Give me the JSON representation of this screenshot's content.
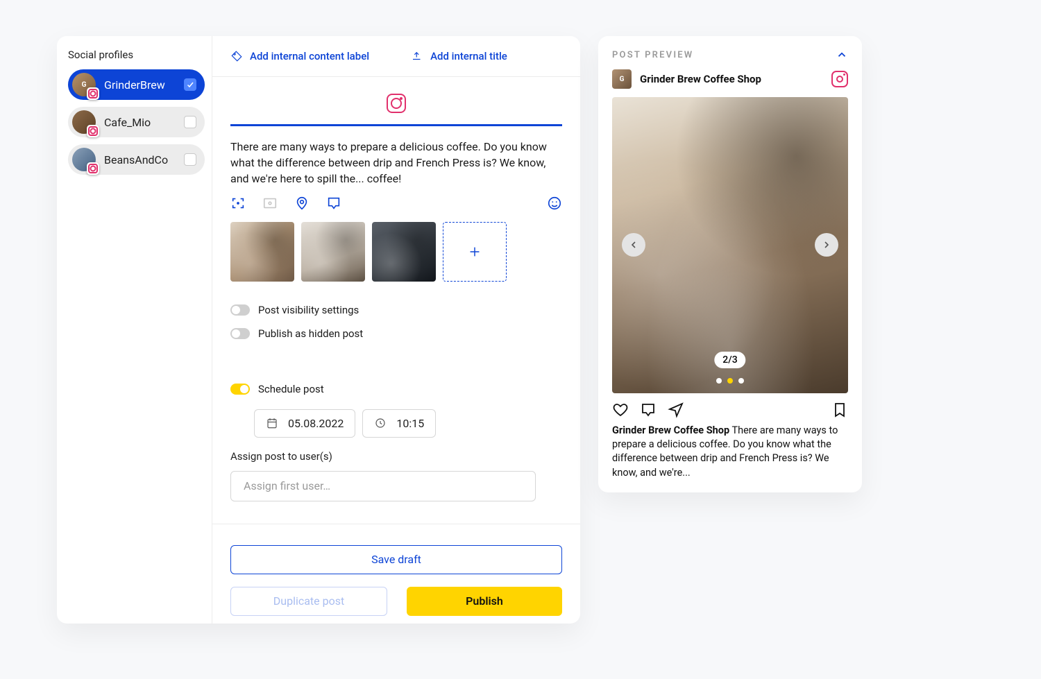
{
  "sidebar": {
    "title": "Social profiles",
    "profiles": [
      {
        "name": "GrinderBrew",
        "selected": true
      },
      {
        "name": "Cafe_Mio",
        "selected": false
      },
      {
        "name": "BeansAndCo",
        "selected": false
      }
    ]
  },
  "editor": {
    "add_label_link": "Add internal content label",
    "add_title_link": "Add internal title",
    "caption": "There are many ways to prepare a delicious coffee. Do you know what the difference between drip and French Press is? We know, and we're here to spill the... coffee!",
    "toggles": {
      "visibility": {
        "label": "Post visibility settings",
        "on": false
      },
      "hidden_post": {
        "label": "Publish as hidden post",
        "on": false
      },
      "schedule": {
        "label": "Schedule post",
        "on": true
      }
    },
    "schedule": {
      "date": "05.08.2022",
      "time": "10:15"
    },
    "assign_label": "Assign post to user(s)",
    "assign_placeholder": "Assign first user…",
    "buttons": {
      "save_draft": "Save draft",
      "duplicate": "Duplicate post",
      "publish": "Publish"
    }
  },
  "preview": {
    "heading": "POST PREVIEW",
    "account_name": "Grinder Brew Coffee Shop",
    "counter": "2/3",
    "caption_name": "Grinder Brew Coffee Shop",
    "caption_text": " There are many ways to prepare a delicious coffee. Do you know what the difference between drip and French Press is? We know, and we're..."
  }
}
